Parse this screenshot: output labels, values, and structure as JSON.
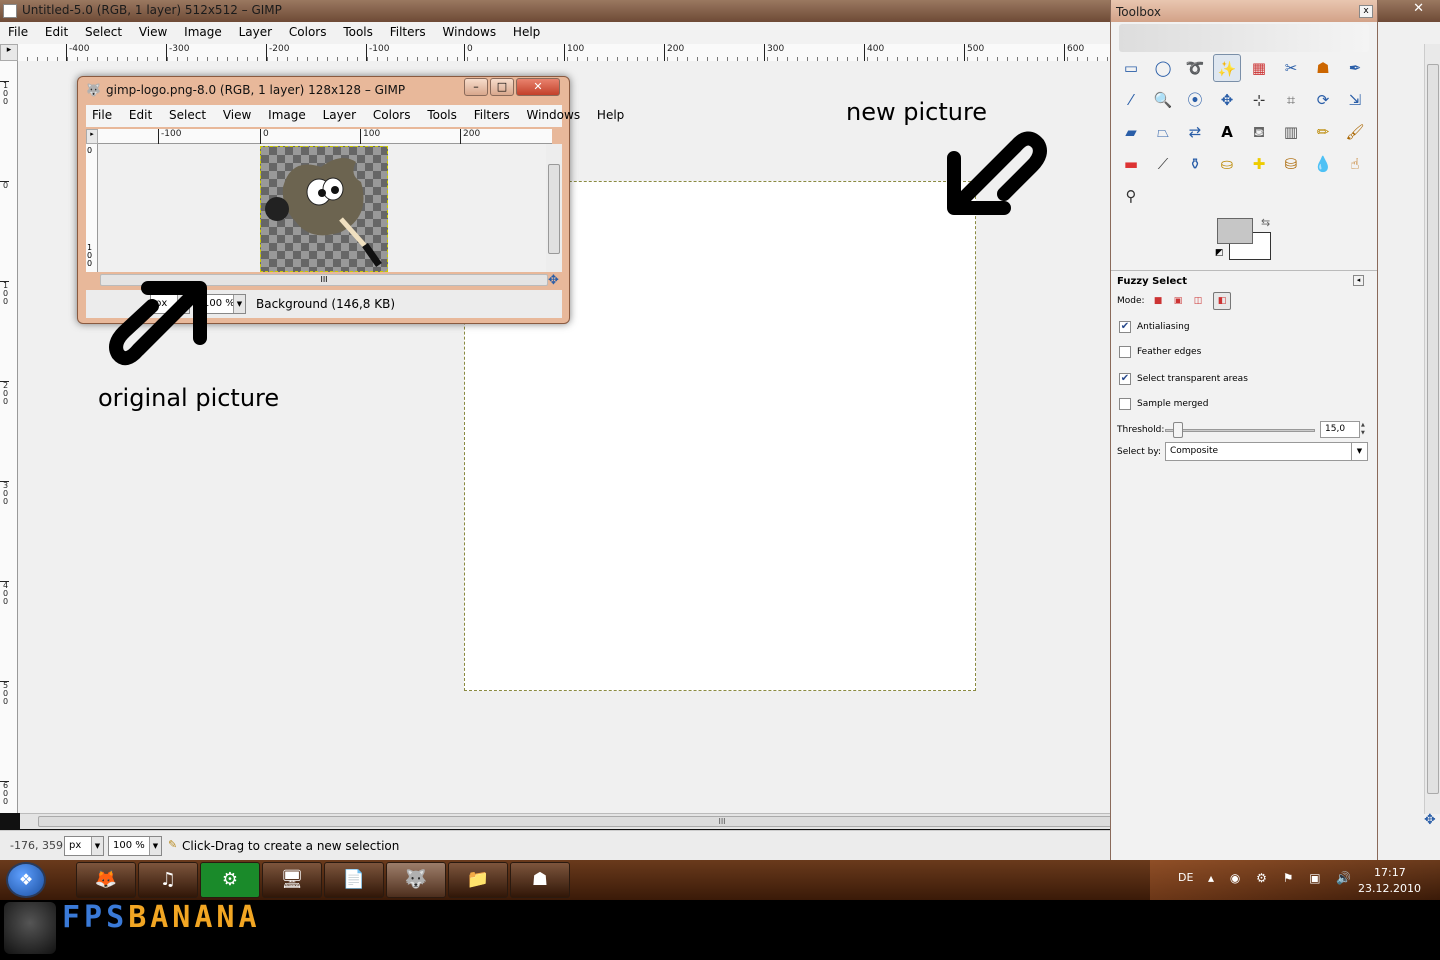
{
  "main_window": {
    "title": "Untitled-5.0 (RGB, 1 layer) 512x512 – GIMP",
    "menu": [
      "File",
      "Edit",
      "Select",
      "View",
      "Image",
      "Layer",
      "Colors",
      "Tools",
      "Filters",
      "Windows",
      "Help"
    ],
    "ruler_ticks": [
      "-400",
      "-300",
      "-200",
      "-100",
      "0",
      "100",
      "200",
      "300",
      "400",
      "500",
      "600"
    ],
    "vruler_ticks": [
      "100",
      "0",
      "100",
      "200",
      "300",
      "400",
      "500",
      "600"
    ],
    "status": {
      "coords": "-176, 359",
      "unit": "px",
      "zoom": "100 %",
      "message": "Click-Drag to create a new selection"
    }
  },
  "logo_window": {
    "title": "gimp-logo.png-8.0 (RGB, 1 layer) 128x128 – GIMP",
    "menu": [
      "File",
      "Edit",
      "Select",
      "View",
      "Image",
      "Layer",
      "Colors",
      "Tools",
      "Filters",
      "Windows",
      "Help"
    ],
    "ruler_ticks": [
      "-100",
      "0",
      "100",
      "200"
    ],
    "vruler_ticks": [
      "0",
      "100"
    ],
    "status": {
      "unit": "px",
      "zoom": "100 %",
      "layer_info": "Background (146,8 KB)"
    }
  },
  "toolbox": {
    "title": "Toolbox",
    "close_label": "x",
    "options_title": "Fuzzy Select",
    "mode_label": "Mode:",
    "options": [
      {
        "label": "Antialiasing",
        "checked": true
      },
      {
        "label": "Feather edges",
        "checked": false
      },
      {
        "label": "Select transparent areas",
        "checked": true
      },
      {
        "label": "Sample merged",
        "checked": false
      }
    ],
    "threshold_label": "Threshold:",
    "threshold_value": "15,0",
    "select_by_label": "Select by:",
    "select_by_value": "Composite"
  },
  "annotations": {
    "new_picture": "new picture",
    "original_picture": "original picture"
  },
  "taskbar": {
    "language": "DE",
    "time": "17:17",
    "date": "23.12.2010"
  },
  "watermark": {
    "part1": "FPS",
    "part2": "BANANA",
    "color1": "#3a7ad8",
    "color2": "#f2a623"
  },
  "colors": {
    "fg": "#c6c6c6",
    "bg": "#ffffff"
  }
}
